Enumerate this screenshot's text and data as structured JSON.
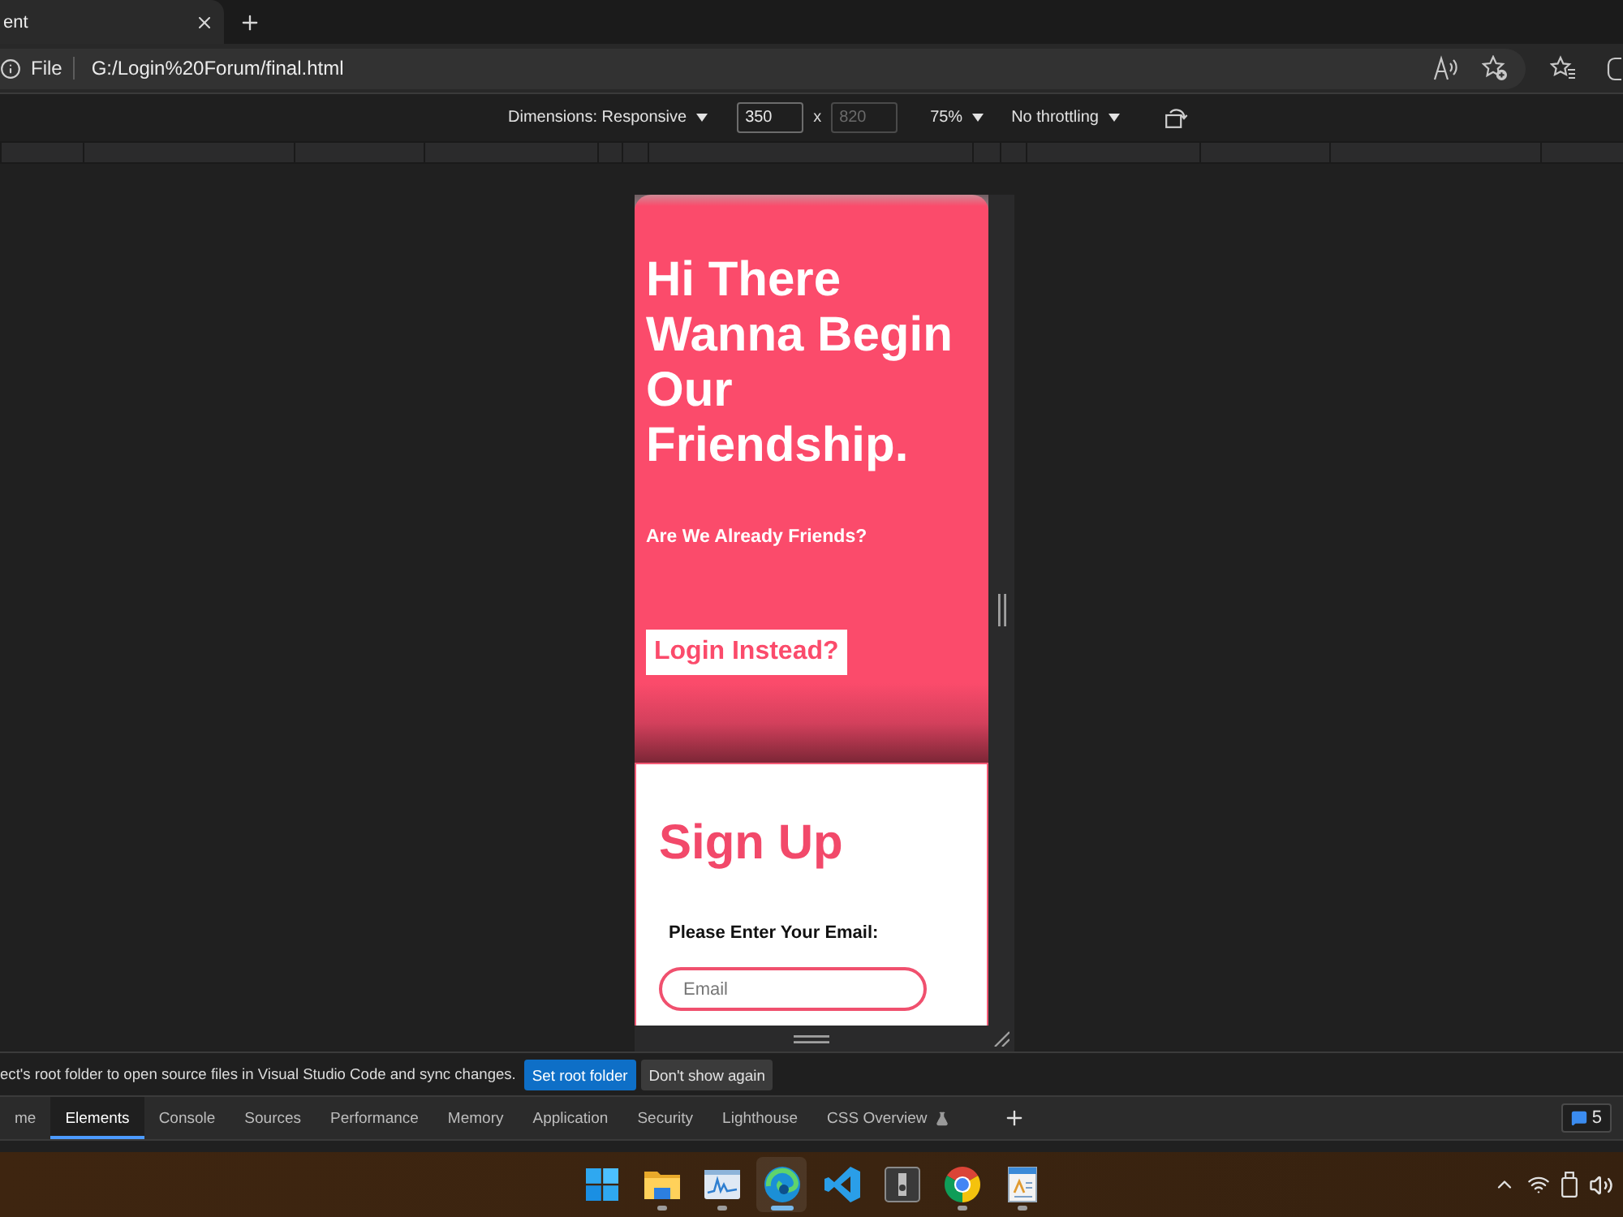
{
  "browser_tab": {
    "title": "ent"
  },
  "address_bar": {
    "scheme": "File",
    "url": "G:/Login%20Forum/final.html"
  },
  "device_toolbar": {
    "dimensions": "Dimensions: Responsive",
    "width": {
      "value": "350",
      "disabled": false
    },
    "separator": "x",
    "height": {
      "value": "820",
      "disabled": true
    },
    "zoom": "75%",
    "throttling": "No throttling"
  },
  "page": {
    "headline": "Hi There Wanna Begin Our Friendship.",
    "subtitle": "Are We Already Friends?",
    "login_button": "Login Instead?",
    "signup": {
      "title": "Sign Up",
      "email_label": "Please Enter Your Email:",
      "email_placeholder": "Email"
    }
  },
  "notification": {
    "message": "ect's root folder to open source files in Visual Studio Code and sync changes.",
    "buttons": [
      {
        "label": "Set root folder",
        "kind": "primary"
      },
      {
        "label": "Don't show again",
        "kind": "secondary"
      }
    ]
  },
  "devtools_tabs": [
    {
      "label": "me",
      "selected": false,
      "experimental": false
    },
    {
      "label": "Elements",
      "selected": true,
      "experimental": false
    },
    {
      "label": "Console",
      "selected": false,
      "experimental": false
    },
    {
      "label": "Sources",
      "selected": false,
      "experimental": false
    },
    {
      "label": "Performance",
      "selected": false,
      "experimental": false
    },
    {
      "label": "Memory",
      "selected": false,
      "experimental": false
    },
    {
      "label": "Application",
      "selected": false,
      "experimental": false
    },
    {
      "label": "Security",
      "selected": false,
      "experimental": false
    },
    {
      "label": "Lighthouse",
      "selected": false,
      "experimental": false
    },
    {
      "label": "CSS Overview",
      "selected": false,
      "experimental": true
    }
  ],
  "issues_badge": {
    "count": "5"
  },
  "taskbar": {
    "apps": [
      {
        "kind": "start",
        "running": false,
        "selected": false
      },
      {
        "kind": "folder",
        "running": true,
        "selected": false
      },
      {
        "kind": "monitor",
        "running": true,
        "selected": false
      },
      {
        "kind": "browser",
        "running": true,
        "selected": true
      },
      {
        "kind": "code",
        "running": false,
        "selected": false
      },
      {
        "kind": "tile",
        "running": false,
        "selected": false
      },
      {
        "kind": "globe",
        "running": true,
        "selected": false
      },
      {
        "kind": "notepad",
        "running": true,
        "selected": false
      }
    ]
  }
}
